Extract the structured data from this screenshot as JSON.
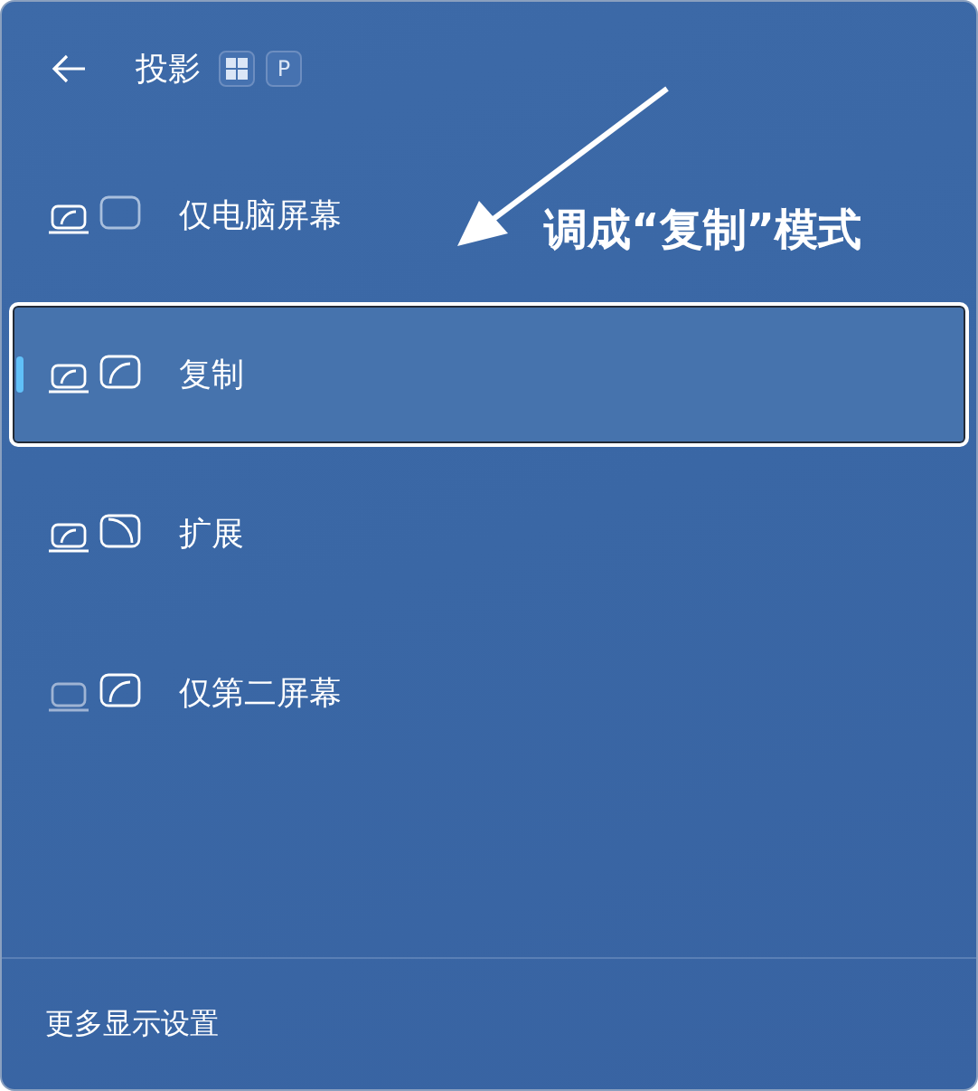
{
  "header": {
    "title": "投影",
    "shortcut_key": "P"
  },
  "items": [
    {
      "label": "仅电脑屏幕",
      "kind": "pc-only",
      "selected": false
    },
    {
      "label": "复制",
      "kind": "duplicate",
      "selected": true
    },
    {
      "label": "扩展",
      "kind": "extend",
      "selected": false
    },
    {
      "label": "仅第二屏幕",
      "kind": "second-only",
      "selected": false
    }
  ],
  "annotation": {
    "text": "调成“复制”模式"
  },
  "footer": {
    "link": "更多显示设置"
  }
}
